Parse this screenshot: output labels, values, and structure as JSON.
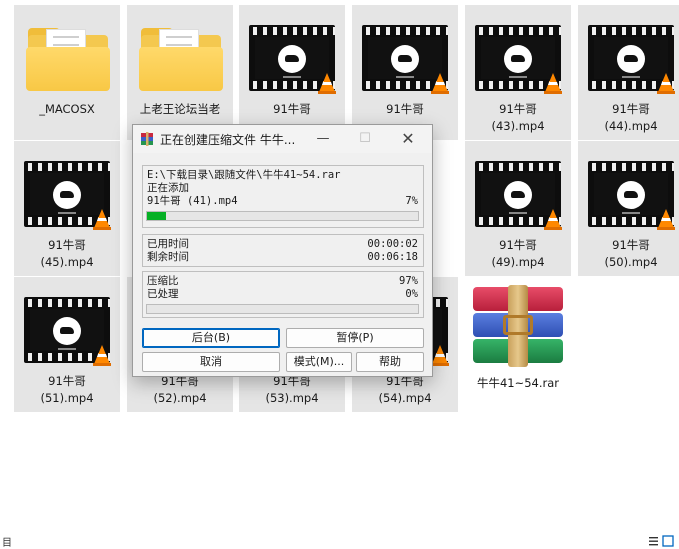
{
  "items": [
    {
      "type": "folder",
      "name": "_MACOSX"
    },
    {
      "type": "folder",
      "name": "上老王论坛当老"
    },
    {
      "type": "video",
      "name": "91牛哥"
    },
    {
      "type": "video",
      "name": "91牛哥"
    },
    {
      "type": "video",
      "name": "91牛哥\n(43).mp4"
    },
    {
      "type": "video",
      "name": "91牛哥\n(44).mp4"
    },
    {
      "type": "video",
      "name": "91牛哥\n(45).mp4"
    },
    {
      "type": "video",
      "name": "91牛哥\n(49).mp4"
    },
    {
      "type": "video",
      "name": "91牛哥\n(50).mp4"
    },
    {
      "type": "video",
      "name": "91牛哥\n(51).mp4"
    },
    {
      "type": "video",
      "name": "91牛哥\n(52).mp4"
    },
    {
      "type": "video",
      "name": "91牛哥\n(53).mp4"
    },
    {
      "type": "video",
      "name": "91牛哥\n(54).mp4"
    }
  ],
  "rar_file": {
    "name": "牛牛41~54.rar"
  },
  "dialog": {
    "title": "正在创建压缩文件 牛牛...",
    "minimize": "—",
    "maximize": "☐",
    "close": "✕",
    "archive_path": "E:\\下载目录\\跟随文件\\牛牛41~54.rar",
    "status": "正在添加",
    "current_file": "91牛哥 (41).mp4",
    "current_percent": "7%",
    "current_progress": 0.07,
    "elapsed_label": "已用时间",
    "elapsed_value": "00:00:02",
    "remaining_label": "剩余时间",
    "remaining_value": "00:06:18",
    "ratio_label": "压缩比",
    "ratio_value": "97%",
    "processed_label": "已处理",
    "processed_value": "0%",
    "processed_progress": 0.0,
    "buttons": {
      "background": "后台(B)",
      "pause": "暂停(P)",
      "cancel": "取消",
      "mode": "模式(M)...",
      "help": "帮助"
    }
  },
  "status_left_char": "目",
  "colors": {
    "progress": "#06b025",
    "tile_bg": "#e5e5e5",
    "focus": "#0067c0"
  }
}
